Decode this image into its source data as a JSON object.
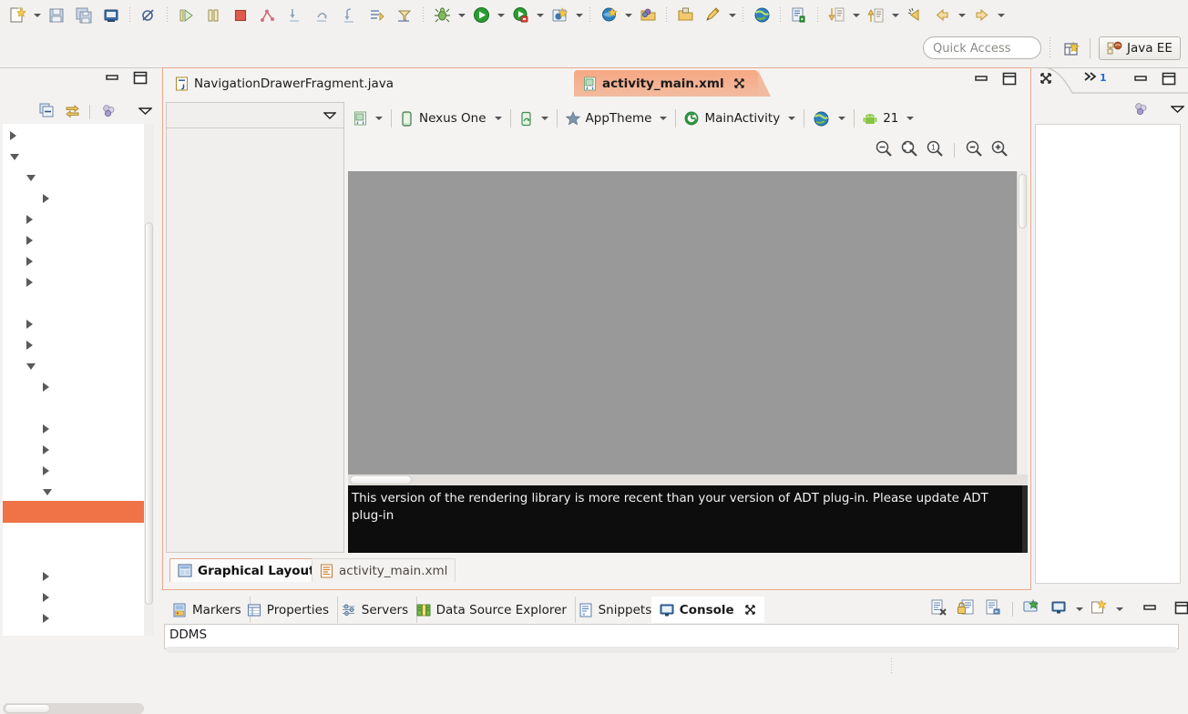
{
  "window": {
    "perspective_label": "Java EE",
    "quick_access_placeholder": "Quick Access"
  },
  "toolbar": {
    "items": [
      {
        "name": "new-wizard",
        "icon": "new-file-icon",
        "caret": true
      },
      {
        "name": "save",
        "icon": "save-icon",
        "caret": false
      },
      {
        "name": "save-all",
        "icon": "save-all-icon",
        "caret": false
      },
      {
        "name": "print",
        "icon": "print-icon",
        "caret": false
      },
      {
        "name": "skip-breakpoints",
        "icon": "skip-breakpoints-icon",
        "caret": false
      },
      {
        "name": "resume",
        "icon": "resume-icon",
        "caret": false
      },
      {
        "name": "suspend",
        "icon": "suspend-icon",
        "caret": false
      },
      {
        "name": "terminate",
        "icon": "terminate-icon",
        "caret": false
      },
      {
        "name": "disconnect",
        "icon": "disconnect-icon",
        "caret": false
      },
      {
        "name": "step-into",
        "icon": "step-into-icon",
        "caret": false
      },
      {
        "name": "step-over",
        "icon": "step-over-icon",
        "caret": false
      },
      {
        "name": "step-return",
        "icon": "step-return-icon",
        "caret": false
      },
      {
        "name": "drop-to-frame",
        "icon": "drop-to-frame-icon",
        "caret": false
      },
      {
        "name": "use-step-filters",
        "icon": "step-filters-icon",
        "caret": false
      },
      {
        "name": "debug",
        "icon": "debug-bug-icon",
        "caret": true
      },
      {
        "name": "run",
        "icon": "run-play-icon",
        "caret": true
      },
      {
        "name": "run-external-tools",
        "icon": "external-tools-icon",
        "caret": true
      },
      {
        "name": "new-android-project",
        "icon": "android-project-icon",
        "caret": true
      },
      {
        "name": "android-sdk-manager",
        "icon": "sdk-manager-icon",
        "caret": true
      },
      {
        "name": "open-package",
        "icon": "open-package-icon",
        "caret": false
      },
      {
        "name": "open-type",
        "icon": "open-type-icon",
        "caret": false
      },
      {
        "name": "new-java-annotation",
        "icon": "pencil-icon",
        "caret": true
      },
      {
        "name": "open-web-browser",
        "icon": "globe-icon",
        "caret": false
      },
      {
        "name": "open-task",
        "icon": "open-task-icon",
        "caret": false
      },
      {
        "name": "next-annotation",
        "icon": "next-annotation-icon",
        "caret": true
      },
      {
        "name": "previous-annotation",
        "icon": "previous-annotation-icon",
        "caret": true
      },
      {
        "name": "last-edit-location",
        "icon": "last-edit-icon",
        "caret": false
      },
      {
        "name": "back",
        "icon": "back-arrow-icon",
        "caret": true
      },
      {
        "name": "forward",
        "icon": "forward-arrow-icon",
        "caret": true
      }
    ]
  },
  "left_view": {
    "toolbar": [
      {
        "name": "collapse-all",
        "icon": "collapse-all-icon"
      },
      {
        "name": "link-with-editor",
        "icon": "link-editor-icon"
      },
      {
        "name": "focus-on-active-task",
        "icon": "focus-task-icon"
      },
      {
        "name": "view-menu",
        "icon": "view-menu-icon"
      }
    ],
    "tree_rows": [
      {
        "indent": 0,
        "state": "closed"
      },
      {
        "indent": 0,
        "state": "open"
      },
      {
        "indent": 1,
        "state": "open"
      },
      {
        "indent": 2,
        "state": "closed"
      },
      {
        "indent": 1,
        "state": "closed"
      },
      {
        "indent": 1,
        "state": "closed"
      },
      {
        "indent": 1,
        "state": "closed"
      },
      {
        "indent": 1,
        "state": "closed"
      },
      {
        "indent": 0,
        "state": "none"
      },
      {
        "indent": 1,
        "state": "closed"
      },
      {
        "indent": 1,
        "state": "closed"
      },
      {
        "indent": 1,
        "state": "open"
      },
      {
        "indent": 2,
        "state": "closed"
      },
      {
        "indent": 2,
        "state": "none"
      },
      {
        "indent": 2,
        "state": "closed"
      },
      {
        "indent": 2,
        "state": "closed"
      },
      {
        "indent": 2,
        "state": "closed"
      },
      {
        "indent": 2,
        "state": "open"
      },
      {
        "indent": 0,
        "state": "selected"
      },
      {
        "indent": 0,
        "state": "none"
      },
      {
        "indent": 0,
        "state": "none"
      },
      {
        "indent": 2,
        "state": "closed"
      },
      {
        "indent": 2,
        "state": "closed"
      },
      {
        "indent": 2,
        "state": "closed"
      }
    ]
  },
  "editor": {
    "tabs": [
      {
        "label": "NavigationDrawerFragment.java",
        "icon": "java-file-icon",
        "active": false,
        "closable": false
      },
      {
        "label": "activity_main.xml",
        "icon": "xml-layout-icon",
        "active": true,
        "closable": true
      }
    ],
    "config_bar": [
      {
        "name": "configuration-chooser",
        "icon": "xml-layout-icon",
        "label": "",
        "caret": true
      },
      {
        "name": "device-chooser",
        "icon": "device-icon",
        "label": "Nexus One",
        "caret": true
      },
      {
        "name": "orientation-chooser",
        "icon": "orientation-icon",
        "label": "",
        "caret": true
      },
      {
        "name": "theme-chooser",
        "icon": "star-icon",
        "label": "AppTheme",
        "caret": true
      },
      {
        "name": "activity-chooser",
        "icon": "activity-icon",
        "label": "MainActivity",
        "caret": true
      },
      {
        "name": "locale-chooser",
        "icon": "globe-icon",
        "label": "",
        "caret": true
      },
      {
        "name": "api-level-chooser",
        "icon": "android-icon",
        "label": "21",
        "caret": true
      }
    ],
    "zoom_buttons": [
      {
        "name": "zoom-to-fit",
        "icon": "zoom-fit-icon"
      },
      {
        "name": "zoom-fit-selection",
        "icon": "zoom-fit-selection-icon"
      },
      {
        "name": "zoom-actual-size",
        "icon": "zoom-100-icon"
      },
      {
        "name": "zoom-out",
        "icon": "zoom-out-icon"
      },
      {
        "name": "zoom-in",
        "icon": "zoom-in-icon"
      }
    ],
    "canvas_color": "#999999",
    "error_message": "This version of the rendering library is more recent than your version of ADT plug-in. Please update ADT plug-in",
    "bottom_tabs": [
      {
        "label": "Graphical Layout",
        "icon": "graphical-layout-icon",
        "active": true
      },
      {
        "label": "activity_main.xml",
        "icon": "xml-source-icon",
        "active": false
      }
    ]
  },
  "right_view": {
    "fastview_badge": "1",
    "buttons": [
      {
        "name": "close-view",
        "icon": "close-icon"
      },
      {
        "name": "restore-fastview",
        "icon": "chevron-right-double-icon"
      },
      {
        "name": "minimize-view",
        "icon": "minimize-icon"
      },
      {
        "name": "maximize-view",
        "icon": "maximize-icon"
      }
    ],
    "toolbar": [
      {
        "name": "focus-on-active-task",
        "icon": "focus-task-icon"
      },
      {
        "name": "view-menu",
        "icon": "view-menu-icon"
      }
    ]
  },
  "bottom_view": {
    "tabs": [
      {
        "label": "Markers",
        "icon": "markers-icon",
        "active": false,
        "closable": false
      },
      {
        "label": "Properties",
        "icon": "properties-icon",
        "active": false,
        "closable": false
      },
      {
        "label": "Servers",
        "icon": "servers-icon",
        "active": false,
        "closable": false
      },
      {
        "label": "Data Source Explorer",
        "icon": "data-source-icon",
        "active": false,
        "closable": false
      },
      {
        "label": "Snippets",
        "icon": "snippets-icon",
        "active": false,
        "closable": false
      },
      {
        "label": "Console",
        "icon": "console-icon",
        "active": true,
        "closable": true
      }
    ],
    "tools": [
      {
        "name": "clear-console",
        "icon": "clear-console-icon",
        "caret": false
      },
      {
        "name": "scroll-lock",
        "icon": "scroll-lock-icon",
        "caret": false
      },
      {
        "name": "pin-console",
        "icon": "pin-console-icon",
        "caret": false
      },
      {
        "name": "display-selected-console",
        "icon": "display-console-icon",
        "caret": false
      },
      {
        "name": "open-console",
        "icon": "console-select-icon",
        "caret": true
      },
      {
        "name": "new-console-view",
        "icon": "new-console-icon",
        "caret": true
      }
    ],
    "content": "DDMS"
  },
  "colors": {
    "accent_orange": "#ef7346",
    "tab_highlight": "#f2bb9f",
    "canvas_gray": "#999999",
    "chrome": "#f2f1f0"
  }
}
